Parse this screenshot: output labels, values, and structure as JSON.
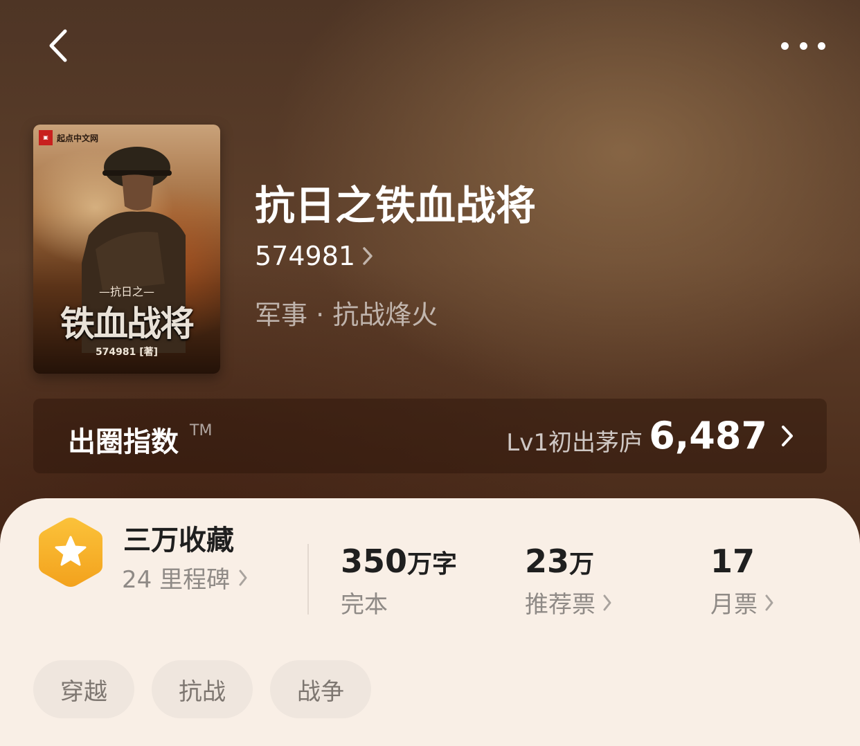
{
  "cover": {
    "publisher": "起点中文网",
    "subtitle": "—抗日之—",
    "title": "铁血战将",
    "author_line": "574981 [著]"
  },
  "book": {
    "title": "抗日之铁血战将",
    "author": "574981",
    "category": "军事 · 抗战烽火"
  },
  "index": {
    "label": "出圈指数",
    "tm": "TM",
    "level": "Lv1初出茅庐",
    "score": "6,487"
  },
  "milestone": {
    "title": "三万收藏",
    "sub": "24 里程碑"
  },
  "stats": [
    {
      "value": "350",
      "unit": "万字",
      "label": "完本"
    },
    {
      "value": "23",
      "unit": "万",
      "label": "推荐票"
    },
    {
      "value": "17",
      "unit": "",
      "label": "月票"
    }
  ],
  "tags": [
    "穿越",
    "抗战",
    "战争"
  ],
  "colors": {
    "badge": "#f7b52a",
    "panel": "#f9efe6",
    "tag_bg": "#efe6de"
  }
}
